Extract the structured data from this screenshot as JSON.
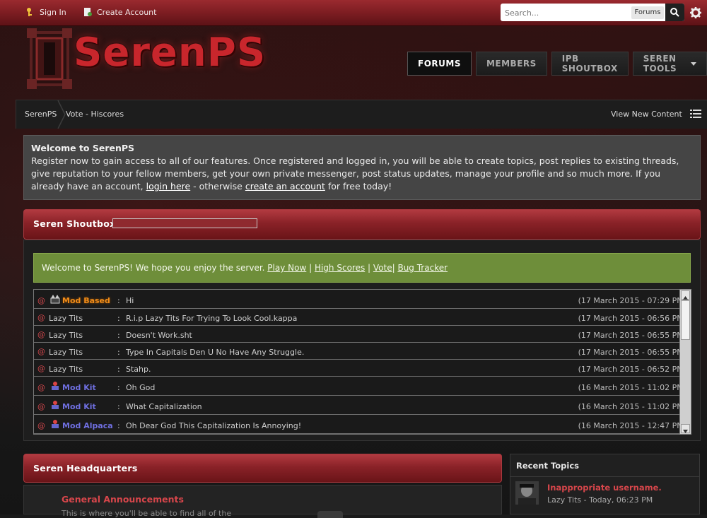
{
  "topbar": {
    "sign_in": "Sign In",
    "create_account": "Create Account",
    "search_placeholder": "Search...",
    "search_scope": "Forums"
  },
  "brand": {
    "logo_text": "SerenPS",
    "accent": "#c8262c"
  },
  "nav": {
    "tabs": [
      "FORUMS",
      "MEMBERS",
      "IPB SHOUTBOX",
      "SEREN TOOLS"
    ],
    "active": "FORUMS"
  },
  "breadcrumb": {
    "items": [
      "SerenPS",
      "Vote - Hiscores"
    ],
    "view_new": "View New Content"
  },
  "welcome": {
    "title": "Welcome to SerenPS",
    "text_before": "Register now to gain access to all of our features. Once registered and logged in, you will be able to create topics, post replies to existing threads, give reputation to your fellow members, get your own private messenger, post status updates, manage your profile and so much more. If you already have an account, ",
    "login_link": "login here",
    "text_middle": " - otherwise ",
    "create_link": "create an account",
    "text_after": " for free today!"
  },
  "shoutbox": {
    "title": "Seren Shoutbox",
    "announcement": {
      "text": "Welcome to SerenPS! We hope you enjoy the server. ",
      "links": [
        "Play Now",
        "High Scores",
        "Vote",
        "Bug Tracker"
      ]
    },
    "messages": [
      {
        "user": "Mod Based",
        "mod": true,
        "color": "#f08c1a",
        "text": "Hi",
        "time": "(17 March 2015 - 07:29 PM)"
      },
      {
        "user": "Lazy Tits",
        "mod": false,
        "text": "R.i.p Lazy Tits For Trying To Look Cool.kappa",
        "time": "(17 March 2015 - 06:56 PM)"
      },
      {
        "user": "Lazy Tits",
        "mod": false,
        "text": "Doesn't Work.sht",
        "time": "(17 March 2015 - 06:55 PM)"
      },
      {
        "user": "Lazy Tits",
        "mod": false,
        "text": "Type In Capitals Den U No Have Any Struggle.",
        "time": "(17 March 2015 - 06:55 PM)"
      },
      {
        "user": "Lazy Tits",
        "mod": false,
        "text": "Stahp.",
        "time": "(17 March 2015 - 06:52 PM)"
      },
      {
        "user": "Mod Kit",
        "mod": true,
        "color": "#6f6fe0",
        "text": "Oh God",
        "time": "(16 March 2015 - 11:02 PM)"
      },
      {
        "user": "Mod Kit",
        "mod": true,
        "color": "#6f6fe0",
        "text": "What Capitalization",
        "time": "(16 March 2015 - 11:02 PM)"
      },
      {
        "user": "Mod Alpaca",
        "mod": true,
        "color": "#6f6fe0",
        "text": "Oh Dear God This Capitalization Is Annoying!",
        "time": "(16 March 2015 - 12:47 PM)"
      }
    ]
  },
  "headquarters": {
    "title": "Seren Headquarters",
    "category_title": "General Announcements",
    "category_desc": "This is where you'll be able to find all of the"
  },
  "recent_topics": {
    "title": "Recent Topics",
    "items": [
      {
        "title": "Inappropriate username.",
        "meta": "Lazy Tits - Today, 06:23 PM"
      }
    ]
  }
}
